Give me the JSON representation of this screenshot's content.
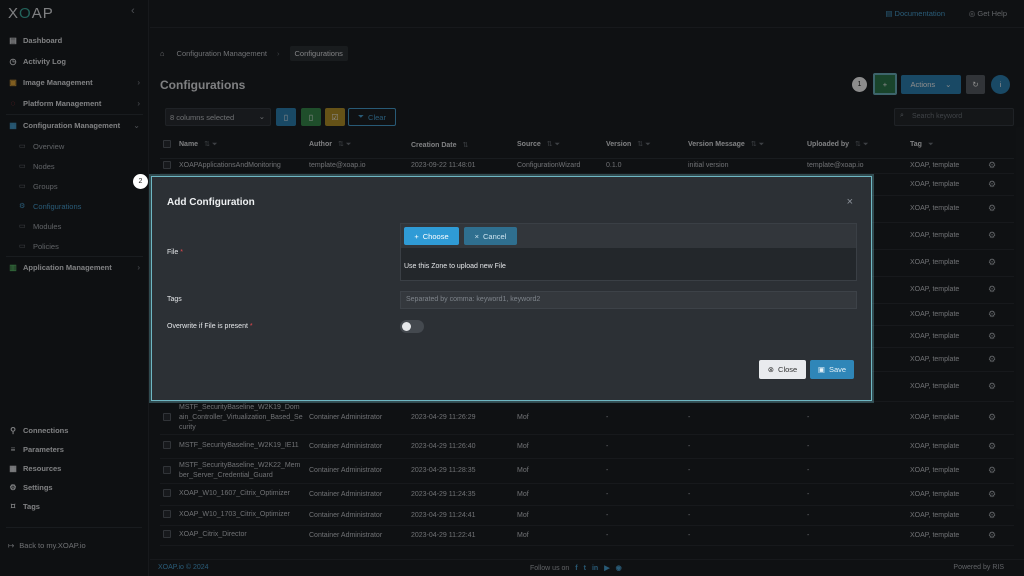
{
  "app": {
    "logo_text": "XOAP",
    "logo_accent": "O"
  },
  "sidebar": {
    "items": [
      {
        "label": "Dashboard"
      },
      {
        "label": "Activity Log"
      },
      {
        "label": "Image Management"
      },
      {
        "label": "Platform Management"
      },
      {
        "label": "Configuration Management"
      },
      {
        "label": "Application Management"
      }
    ],
    "sub_items": [
      {
        "label": "Overview"
      },
      {
        "label": "Nodes"
      },
      {
        "label": "Groups"
      },
      {
        "label": "Configurations"
      },
      {
        "label": "Modules"
      },
      {
        "label": "Policies"
      }
    ],
    "bottom_items": [
      {
        "label": "Connections"
      },
      {
        "label": "Parameters"
      },
      {
        "label": "Resources"
      },
      {
        "label": "Settings"
      },
      {
        "label": "Tags"
      }
    ],
    "back_label": "Back to my.XOAP.io"
  },
  "topbar": {
    "documentation": "Documentation",
    "help": "Get Help"
  },
  "breadcrumb": {
    "parent": "Configuration Management",
    "current": "Configurations"
  },
  "page": {
    "title": "Configurations",
    "actions_label": "Actions",
    "step_1": "1",
    "step_2": "2"
  },
  "toolbar": {
    "columns_selected": "8 columns selected",
    "clear_label": "Clear",
    "search_placeholder": "Search keyword"
  },
  "table": {
    "columns": [
      "Name",
      "Author",
      "Creation Date",
      "Source",
      "Version",
      "Version Message",
      "Uploaded by",
      "Tag"
    ],
    "rows": [
      {
        "name": "XOAPApplicationsAndMonitoring",
        "author": "template@xoap.io",
        "date": "2023-09-22 11:48:01",
        "source": "ConfigurationWizard",
        "version": "0.1.0",
        "message": "initial version",
        "uploaded": "template@xoap.io",
        "tag": "XOAP, template"
      },
      {
        "name": "",
        "author": "",
        "date": "",
        "source": "",
        "version": "",
        "message": "",
        "uploaded": "",
        "tag": "XOAP, template"
      },
      {
        "name": "",
        "author": "",
        "date": "",
        "source": "",
        "version": "",
        "message": "",
        "uploaded": "",
        "tag": "XOAP, template"
      },
      {
        "name": "",
        "author": "",
        "date": "",
        "source": "",
        "version": "",
        "message": "",
        "uploaded": "",
        "tag": "XOAP, template"
      },
      {
        "name": "",
        "author": "",
        "date": "",
        "source": "",
        "version": "",
        "message": "",
        "uploaded": "",
        "tag": "XOAP, template"
      },
      {
        "name": "",
        "author": "",
        "date": "",
        "source": "",
        "version": "",
        "message": "",
        "uploaded": "",
        "tag": "XOAP, template"
      },
      {
        "name": "",
        "author": "",
        "date": "",
        "source": "",
        "version": "",
        "message": "",
        "uploaded": "",
        "tag": "XOAP, template"
      },
      {
        "name": "",
        "author": "",
        "date": "",
        "source": "",
        "version": "",
        "message": "",
        "uploaded": "",
        "tag": "XOAP, template"
      },
      {
        "name": "",
        "author": "",
        "date": "",
        "source": "",
        "version": "",
        "message": "",
        "uploaded": "",
        "tag": "XOAP, template"
      },
      {
        "name": "",
        "author": "",
        "date": "",
        "source": "",
        "version": "",
        "message": "",
        "uploaded": "",
        "tag": "XOAP, template"
      },
      {
        "name": "MSTF_SecurityBaseline_W2K19_Domain_Controller_Virtualization_Based_Security",
        "author": "Container Administrator",
        "date": "2023-04-29 11:26:29",
        "source": "Mof",
        "version": "-",
        "message": "-",
        "uploaded": "-",
        "tag": "XOAP, template"
      },
      {
        "name": "MSTF_SecurityBaseline_W2K19_IE11",
        "author": "Container Administrator",
        "date": "2023-04-29 11:26:40",
        "source": "Mof",
        "version": "-",
        "message": "-",
        "uploaded": "-",
        "tag": "XOAP, template"
      },
      {
        "name": "MSTF_SecurityBaseline_W2K22_Member_Server_Credential_Guard",
        "author": "Container Administrator",
        "date": "2023-04-29 11:28:35",
        "source": "Mof",
        "version": "-",
        "message": "-",
        "uploaded": "-",
        "tag": "XOAP, template"
      },
      {
        "name": "XOAP_W10_1607_Citrix_Optimizer",
        "author": "Container Administrator",
        "date": "2023-04-29 11:24:35",
        "source": "Mof",
        "version": "-",
        "message": "-",
        "uploaded": "-",
        "tag": "XOAP, template"
      },
      {
        "name": "XOAP_W10_1703_Citrix_Optimizer",
        "author": "Container Administrator",
        "date": "2023-04-29 11:24:41",
        "source": "Mof",
        "version": "-",
        "message": "-",
        "uploaded": "-",
        "tag": "XOAP, template"
      },
      {
        "name": "XOAP_Citrix_Director",
        "author": "Container Administrator",
        "date": "2023-04-29 11:22:41",
        "source": "Mof",
        "version": "-",
        "message": "-",
        "uploaded": "-",
        "tag": "XOAP, template"
      }
    ]
  },
  "modal": {
    "title": "Add Configuration",
    "file_label": "File",
    "choose_label": "Choose",
    "cancel_label": "Cancel",
    "upload_hint": "Use this Zone to upload new File",
    "tags_label": "Tags",
    "tags_placeholder": "Separated by comma: keyword1, keyword2",
    "overwrite_label": "Overwrite if File is present",
    "required_mark": "*",
    "close_label": "Close",
    "save_label": "Save"
  },
  "footer": {
    "copyright": "XOAP.io © 2024",
    "follow": "Follow us on",
    "powered": "Powered by RIS"
  },
  "colors": {
    "accent": "#4aa5d8",
    "add_green": "#2e7d4f",
    "modal_border": "#6fb7c3",
    "required": "#e5484d"
  }
}
